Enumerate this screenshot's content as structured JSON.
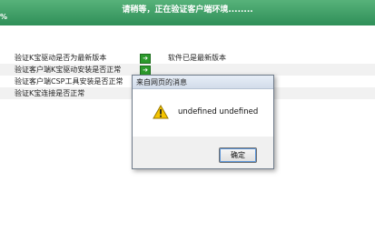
{
  "header": {
    "title": "请稍等，正在验证客户端环境........",
    "percent": "%"
  },
  "checks": [
    {
      "label": "验证K宝驱动是否为最新版本",
      "status": "软件已是最新版本"
    },
    {
      "label": "验证客户端K宝驱动安装是否正常",
      "status": ""
    },
    {
      "label": "验证客户端CSP工具安装是否正常",
      "status": ""
    },
    {
      "label": "验证K宝连接是否正常",
      "status": ""
    }
  ],
  "dialog": {
    "title": "来自网页的消息",
    "icon": "warning-icon",
    "message": "undefined undefined",
    "ok_label": "确定"
  },
  "colors": {
    "header_green": "#3a9a63",
    "status_icon_green": "#2c9a2c"
  }
}
